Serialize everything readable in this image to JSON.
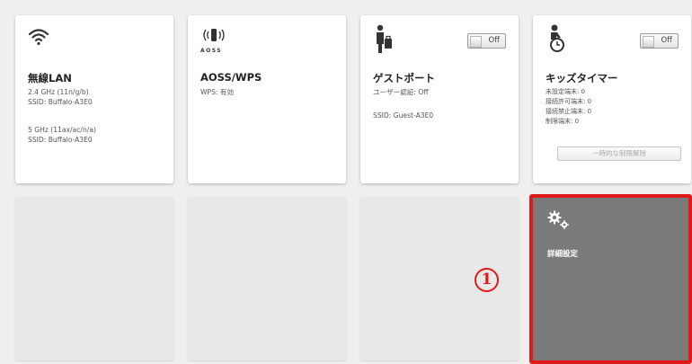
{
  "tiles": {
    "wlan": {
      "title": "無線LAN",
      "band1": "2.4 GHz (11n/g/b)",
      "ssid1": "SSID: Buffalo-A3E0",
      "band2": "5 GHz (11ax/ac/n/a)",
      "ssid2": "SSID: Buffalo-A3E0",
      "icon": "wifi-icon"
    },
    "aoss": {
      "title": "AOSS/WPS",
      "icon_text": "AOSS",
      "wps": "WPS: 有効",
      "icon": "aoss-icon"
    },
    "guest": {
      "title": "ゲストポート",
      "toggle": "Off",
      "auth": "ユーザー認証: Off",
      "ssid": "SSID: Guest-A3E0",
      "icon": "guest-person-icon"
    },
    "kids": {
      "title": "キッズタイマー",
      "toggle": "Off",
      "lines": [
        "未設定端末: 0",
        "接続許可端末: 0",
        "接続禁止端末: 0",
        "制限端末: 0"
      ],
      "button": "一時的な制限解除",
      "icon": "kids-timer-icon"
    },
    "advanced": {
      "title": "詳細設定",
      "icon": "gears-icon"
    }
  },
  "marker": "1",
  "colors": {
    "highlight": "#e0191b",
    "dark_tile": "#7a7a7a",
    "background": "#efefef"
  }
}
